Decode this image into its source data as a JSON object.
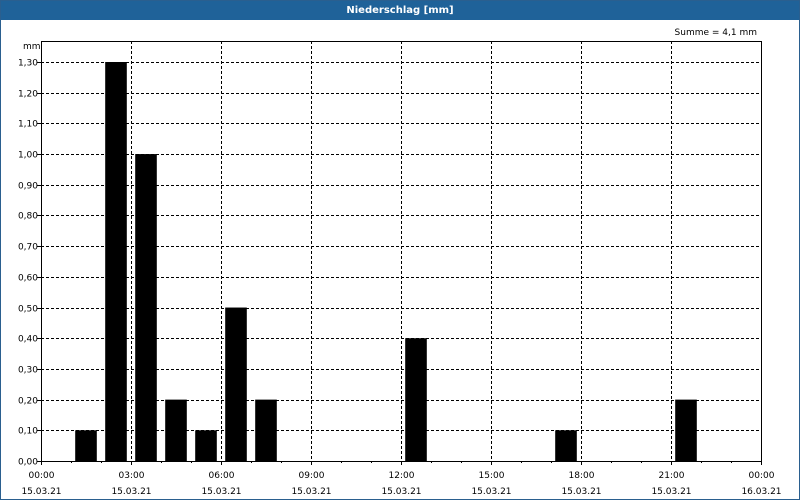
{
  "window": {
    "title": "Niederschlag [mm]"
  },
  "chart_data": {
    "type": "bar",
    "title": "Niederschlag [mm]",
    "ylabel": "mm",
    "xlabel": "",
    "ylim": [
      0,
      1.3
    ],
    "y_ticks": [
      "0,00",
      "0,10",
      "0,20",
      "0,30",
      "0,40",
      "0,50",
      "0,60",
      "0,70",
      "0,80",
      "0,90",
      "1,00",
      "1,10",
      "1,20",
      "1,30"
    ],
    "x_range_hours": [
      0,
      24
    ],
    "x_ticks": [
      {
        "hour": 0,
        "time": "00:00",
        "date": "15.03.21"
      },
      {
        "hour": 3,
        "time": "03:00",
        "date": "15.03.21"
      },
      {
        "hour": 6,
        "time": "06:00",
        "date": "15.03.21"
      },
      {
        "hour": 9,
        "time": "09:00",
        "date": "15.03.21"
      },
      {
        "hour": 12,
        "time": "12:00",
        "date": "15.03.21"
      },
      {
        "hour": 15,
        "time": "15:00",
        "date": "15.03.21"
      },
      {
        "hour": 18,
        "time": "18:00",
        "date": "15.03.21"
      },
      {
        "hour": 21,
        "time": "21:00",
        "date": "15.03.21"
      },
      {
        "hour": 24,
        "time": "00:00",
        "date": "16.03.21"
      }
    ],
    "bars": [
      {
        "hour": 1.5,
        "value": 0.1
      },
      {
        "hour": 2.5,
        "value": 1.3
      },
      {
        "hour": 3.5,
        "value": 1.0
      },
      {
        "hour": 4.5,
        "value": 0.2
      },
      {
        "hour": 5.5,
        "value": 0.1
      },
      {
        "hour": 6.5,
        "value": 0.5
      },
      {
        "hour": 7.5,
        "value": 0.2
      },
      {
        "hour": 12.5,
        "value": 0.4
      },
      {
        "hour": 17.5,
        "value": 0.1
      },
      {
        "hour": 21.5,
        "value": 0.2
      }
    ],
    "annotation": "Summe = 4,1 mm",
    "grid": true,
    "legend": "none",
    "colors": {
      "bar": "#000000",
      "title_bar": "#1f6299",
      "title_text": "#ffffff"
    }
  }
}
